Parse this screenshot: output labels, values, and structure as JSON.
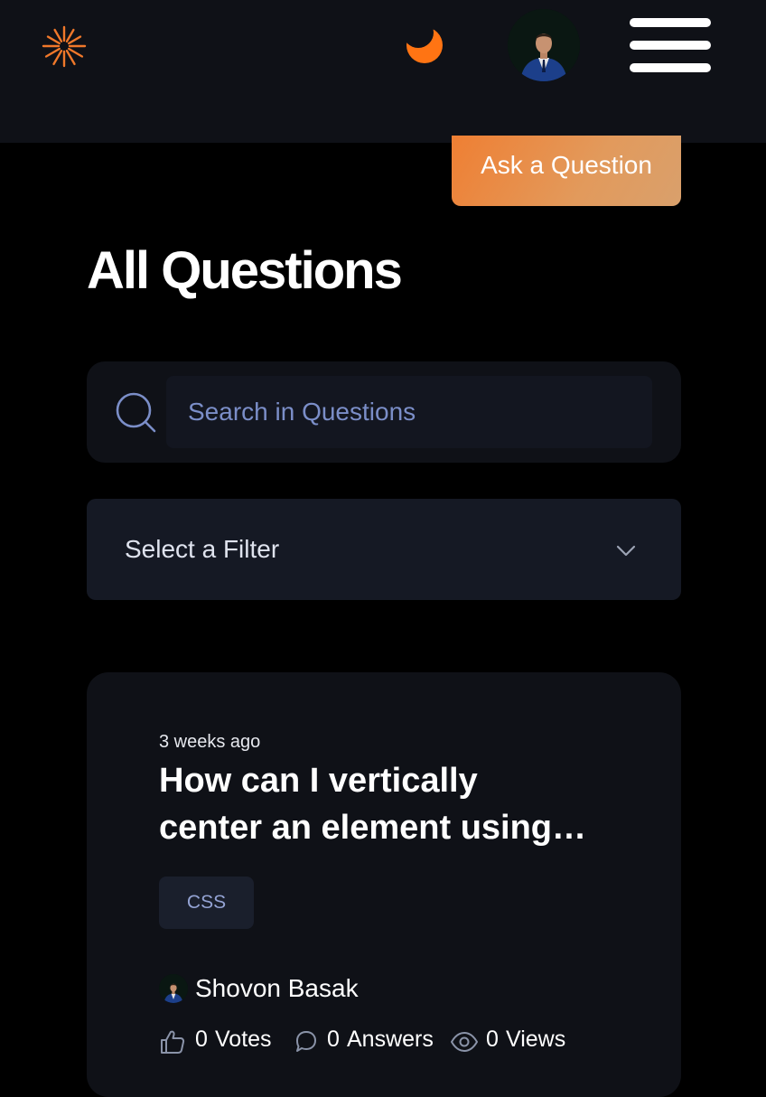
{
  "header": {
    "logo_icon": "sunburst-logo-icon",
    "theme_toggle_icon": "moon-icon",
    "avatar_alt": "user avatar",
    "menu_icon": "hamburger-menu-icon",
    "accent_color": "#ef7f33"
  },
  "actions": {
    "ask_question_label": "Ask a Question"
  },
  "page": {
    "title": "All Questions"
  },
  "search": {
    "placeholder": "Search in Questions",
    "value": "",
    "icon": "search-icon"
  },
  "filter": {
    "selected": "Select a Filter",
    "icon": "chevron-down-icon"
  },
  "questions": [
    {
      "time_ago": "3 weeks ago",
      "title_line1": "How can I vertically",
      "title_line2": "center an element using…",
      "tags": [
        "CSS"
      ],
      "author": "Shovon Basak",
      "votes_count": "0",
      "votes_label": "Votes",
      "answers_count": "0",
      "answers_label": "Answers",
      "views_count": "0",
      "views_label": "Views"
    }
  ]
}
